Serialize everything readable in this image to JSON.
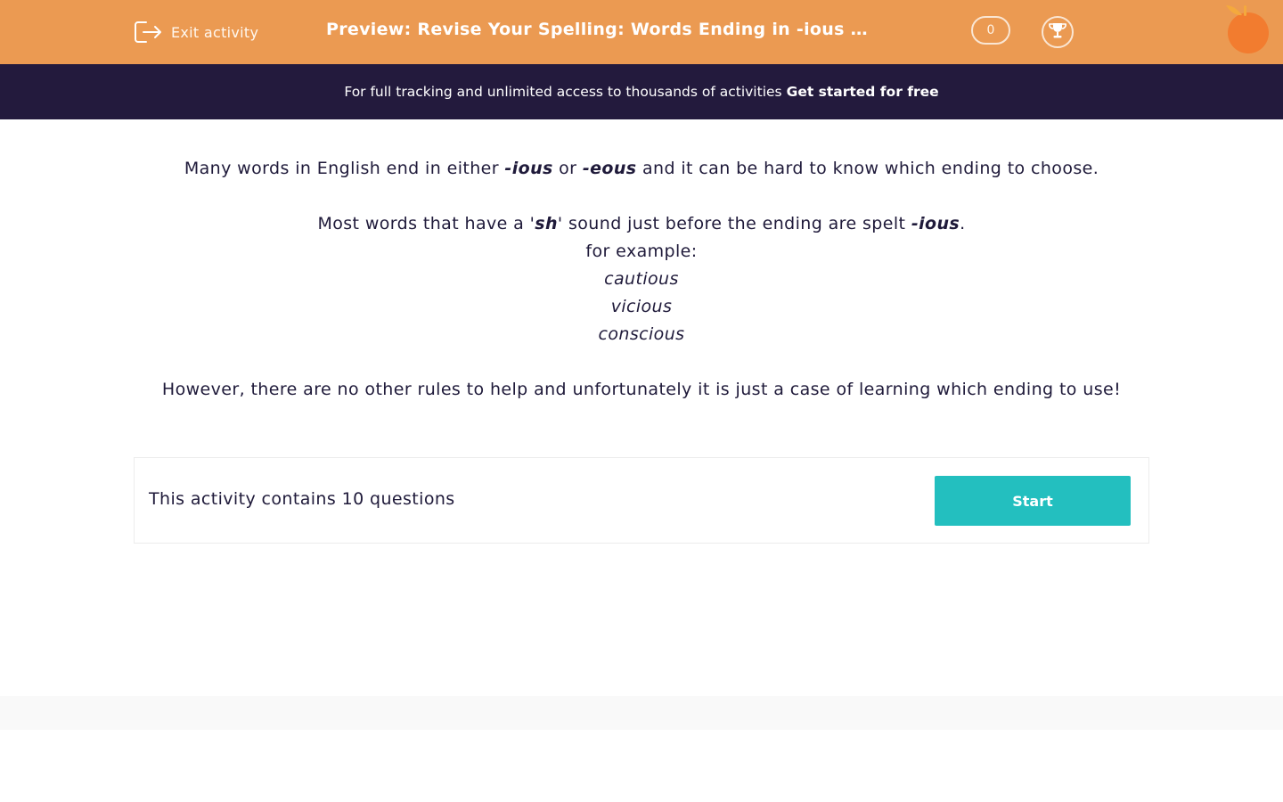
{
  "header": {
    "exit_label": "Exit activity",
    "title": "Preview: Revise Your Spelling: Words Ending in -ious and -eous",
    "score": "0"
  },
  "banner": {
    "text": "For full tracking and unlimited access to thousands of activities",
    "cta": "Get started for free"
  },
  "intro": {
    "p1_a": "Many words in English end in either ",
    "p1_ious": "-ious",
    "p1_or": " or ",
    "p1_eous": "-eous",
    "p1_b": " and it can be hard to know which ending to choose.",
    "p2_a": "Most words that have a '",
    "p2_sh": "sh",
    "p2_b": "' sound just before the ending are spelt ",
    "p2_ious": "-ious",
    "p2_c": ".",
    "for_example": "for example:",
    "examples": [
      "cautious",
      "vicious",
      "conscious"
    ],
    "p3": "However, there are no other rules to help and unfortunately it is just a case of learning which ending to use!"
  },
  "card": {
    "text": "This activity contains 10 questions",
    "start_label": "Start"
  },
  "colors": {
    "header_bg": "#eb9a52",
    "banner_bg": "#231a3d",
    "start_button": "#23bfbf",
    "text": "#1f1a3a"
  },
  "icons": {
    "exit": "exit-door-icon",
    "trophy": "trophy-icon",
    "logo": "orange-logo-icon"
  }
}
